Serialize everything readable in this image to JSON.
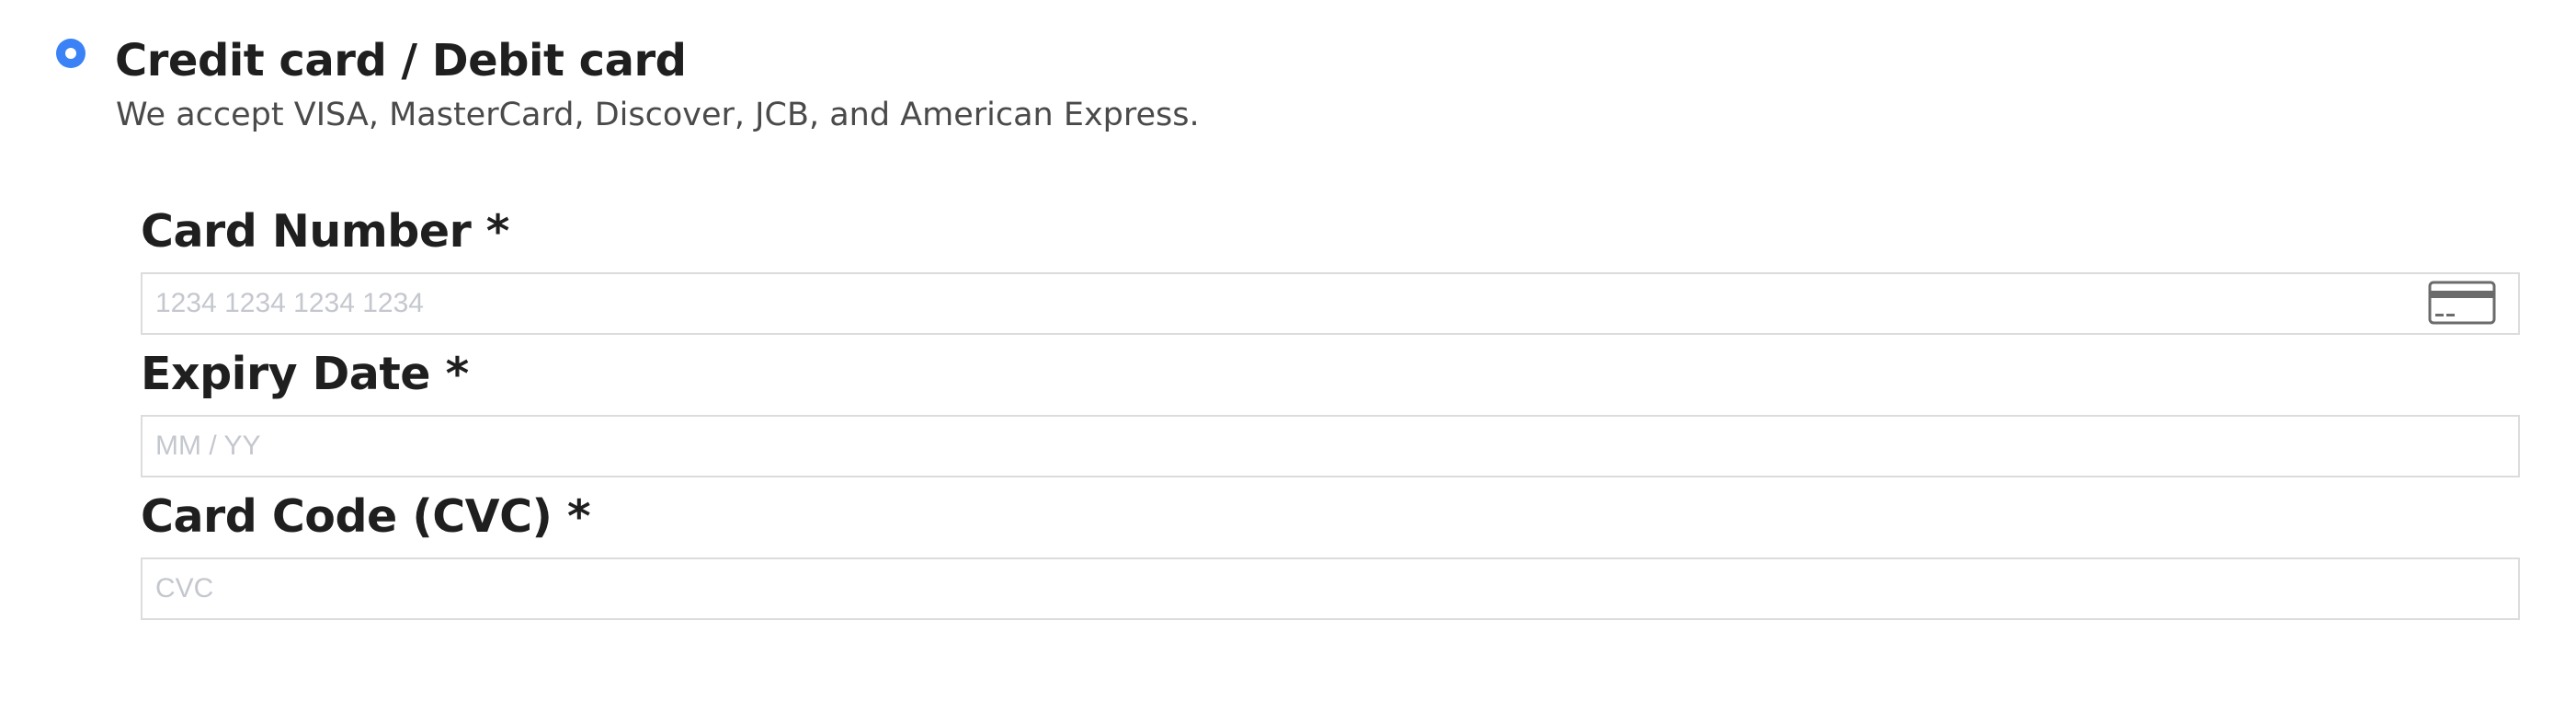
{
  "payment_option": {
    "title": "Credit card / Debit card",
    "description": "We accept VISA, MasterCard, Discover, JCB, and American Express.",
    "selected": true,
    "accent_color": "#3b82f6"
  },
  "fields": {
    "card_number": {
      "label": "Card Number *",
      "placeholder": "1234 1234 1234 1234",
      "value": "",
      "icon": "credit-card-icon"
    },
    "expiry": {
      "label": "Expiry Date *",
      "placeholder": "MM / YY",
      "value": ""
    },
    "cvc": {
      "label": "Card Code (CVC) *",
      "placeholder": "CVC",
      "value": ""
    }
  }
}
